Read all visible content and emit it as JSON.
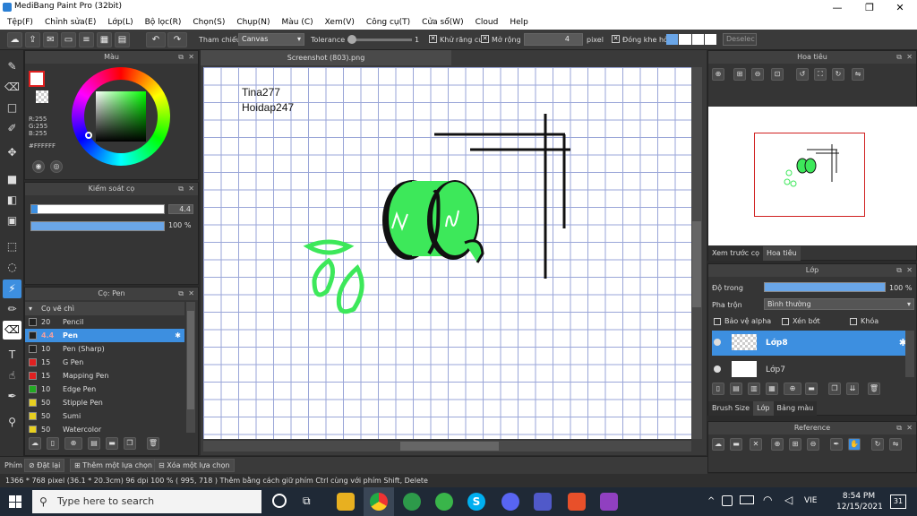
{
  "titlebar": {
    "title": "MediBang Paint Pro (32bit)",
    "minimize": "—",
    "restore": "❐",
    "close": "✕"
  },
  "menu": [
    "Tệp(F)",
    "Chỉnh sửa(E)",
    "Lớp(L)",
    "Bộ lọc(R)",
    "Chọn(S)",
    "Chụp(N)",
    "Màu (C)",
    "Xem(V)",
    "Công cụ(T)",
    "Cửa sổ(W)",
    "Cloud",
    "Help"
  ],
  "toolbar": {
    "reference_label": "Tham chiếu",
    "reference_value": "Canvas",
    "tolerance_label": "Tolerance",
    "tolerance_value": "1",
    "antialias_label": "Khử răng cưa",
    "expand_label": "Mở rộng",
    "expand_value": "4",
    "expand_unit": "pixel",
    "close_gap_label": "Đóng khe hở",
    "deselect": "Deselec"
  },
  "color_panel": {
    "title": "Màu",
    "r": "R:255",
    "g": "G:255",
    "b": "B:255",
    "hex": "#FFFFFF"
  },
  "brush_control": {
    "title": "Kiểm soát cọ",
    "size": "4.4",
    "opacity": "100 %",
    "size_fraction": 0.05,
    "opacity_fraction": 1.0
  },
  "brush_panel": {
    "title": "Cọ: Pen",
    "group": "Cọ vẽ chì",
    "items": [
      {
        "size": "20",
        "name": "Pencil",
        "color": "#222222"
      },
      {
        "size": "4.4",
        "name": "Pen",
        "color": "#222222",
        "active": true
      },
      {
        "size": "10",
        "name": "Pen (Sharp)",
        "color": "#222222"
      },
      {
        "size": "15",
        "name": "G Pen",
        "color": "#e02020"
      },
      {
        "size": "15",
        "name": "Mapping Pen",
        "color": "#e02020"
      },
      {
        "size": "10",
        "name": "Edge Pen",
        "color": "#22aa22"
      },
      {
        "size": "50",
        "name": "Stipple Pen",
        "color": "#e8d020"
      },
      {
        "size": "50",
        "name": "Sumi",
        "color": "#e8d020"
      },
      {
        "size": "50",
        "name": "Watercolor",
        "color": "#e8d020"
      }
    ]
  },
  "canvas": {
    "tab": "Screenshot (803).png",
    "text_line1": "Tina277",
    "text_line2": "Hoidap247",
    "colors": {
      "green": "#3de85a",
      "black": "#111111"
    }
  },
  "navigator": {
    "title": "Hoa tiêu",
    "tab1": "Xem trước cọ",
    "tab2": "Hoa tiêu"
  },
  "layer_panel": {
    "title": "Lớp",
    "opacity_label": "Độ trong",
    "opacity_value": "100 %",
    "blend_label": "Pha trộn",
    "blend_value": "Bình thường",
    "protect_alpha": "Bảo vệ alpha",
    "clipping": "Xén bớt",
    "lock": "Khóa",
    "layers": [
      {
        "name": "Lớp8",
        "active": true
      },
      {
        "name": "Lớp7",
        "active": false
      }
    ],
    "tab1": "Brush Size",
    "tab2": "Lớp",
    "tab3": "Bảng màu"
  },
  "reference_panel": {
    "title": "Reference"
  },
  "statusbar": {
    "shortcut": "Phím",
    "deselect": "Đặt lại",
    "add_selection": "Thêm một lựa chọn",
    "remove_selection": "Xóa một lựa chọn",
    "info": "1366 * 768 pixel   (36.1 * 20.3cm)   96 dpi   100 %   ( 995, 718 )   Thêm bằng cách giữ phím Ctrl cùng với phím Shift, Delete"
  },
  "taskbar": {
    "search_placeholder": "Type here to search",
    "lang": "VIE",
    "time": "8:54 PM",
    "date": "12/15/2021",
    "notif": "31"
  }
}
